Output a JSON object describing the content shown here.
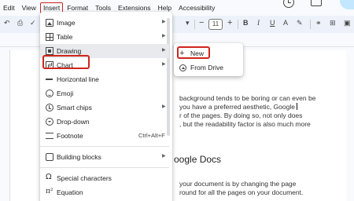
{
  "menubar": {
    "items": [
      "Edit",
      "View",
      "Insert",
      "Format",
      "Tools",
      "Extensions",
      "Help",
      "Accessibility"
    ]
  },
  "toolbar": {
    "font_size": "11",
    "minus": "−",
    "plus": "+"
  },
  "insert_menu": {
    "items": [
      {
        "label": "Image",
        "icon": "image-icon",
        "arrow": "▶"
      },
      {
        "label": "Table",
        "icon": "table-icon",
        "arrow": "▶"
      },
      {
        "label": "Drawing",
        "icon": "drawing-icon",
        "arrow": "▶"
      },
      {
        "label": "Chart",
        "icon": "chart-icon",
        "arrow": "▶"
      },
      {
        "label": "Horizontal line",
        "icon": "horizontal-line-icon"
      },
      {
        "label": "Emoji",
        "icon": "emoji-icon"
      },
      {
        "label": "Smart chips",
        "icon": "smart-chips-icon",
        "arrow": "▶"
      },
      {
        "label": "Drop-down",
        "icon": "dropdown-icon"
      },
      {
        "label": "Footnote",
        "icon": "footnote-icon",
        "shortcut": "Ctrl+Alt+F"
      },
      {
        "label": "Building blocks",
        "icon": "building-blocks-icon",
        "arrow": "▶"
      },
      {
        "label": "Special characters",
        "icon": "omega-icon"
      },
      {
        "label": "Equation",
        "icon": "pi-icon"
      }
    ]
  },
  "drawing_submenu": {
    "items": [
      {
        "label": "New",
        "icon": "plus-icon"
      },
      {
        "label": "From Drive",
        "icon": "drive-icon"
      }
    ]
  },
  "document": {
    "lines": [
      "background tends to be boring or can even be",
      "you have a preferred aesthetic, Google",
      "r of the pages. By doing so, not only does",
      ", but the readability factor is also much more"
    ],
    "heading": "oogle Docs",
    "lines2": [
      "your document is by changing the page",
      "round for all the pages on your document."
    ]
  },
  "colors": {
    "highlight": "#d0251d",
    "menu_bg": "#ffffff",
    "toolbar_bg": "#edf2fa"
  }
}
